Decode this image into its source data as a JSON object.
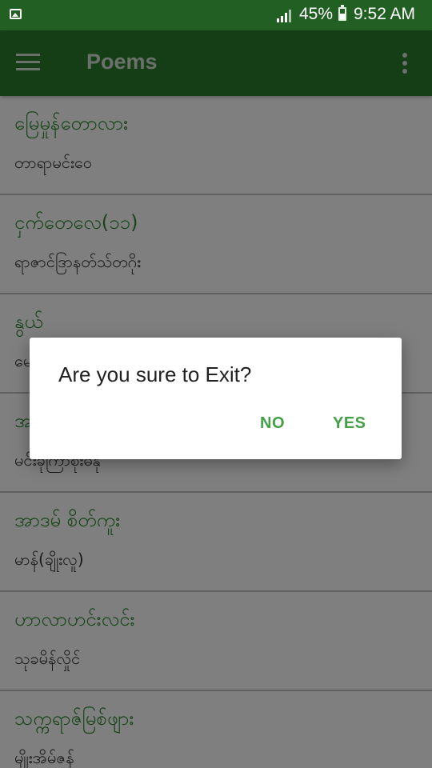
{
  "status_bar": {
    "battery_percent": "45%",
    "time": "9:52 AM",
    "icons": [
      "image-notification-icon",
      "signal-icon",
      "battery-icon"
    ]
  },
  "app_bar": {
    "title": "Poems",
    "menu_icon": "hamburger-menu-icon",
    "overflow_icon": "more-vert-icon"
  },
  "poems": [
    {
      "title": "မြေမှုန်တောလား",
      "author": "တာရာမင်းဝေ"
    },
    {
      "title": "ငှက်တေလေ(၁၁)",
      "author": "ရာဇာင်ဒြာနတ်သ်တဂိုး"
    },
    {
      "title": "နွယ်",
      "author": "မေ"
    },
    {
      "title": "အ",
      "author": "မင်းခုကြာစုးဓနု"
    },
    {
      "title": "အာဒမ် စိတ်ကူး",
      "author": "မာန်(ချိုးလူ)"
    },
    {
      "title": "ဟာလာဟင်းလင်း",
      "author": "သုခမိန်လှိုင်"
    },
    {
      "title": "သက္ကရာဇ်မြစ်ဖျား",
      "author": "မျိုးအိမ်ဇန်"
    }
  ],
  "dialog": {
    "message": "Are you sure to Exit?",
    "no_label": "NO",
    "yes_label": "YES"
  },
  "colors": {
    "status_bar": "#225f23",
    "app_bar": "#2b7a2d",
    "poem_title": "#2f8a33",
    "dialog_button": "#43a047"
  }
}
